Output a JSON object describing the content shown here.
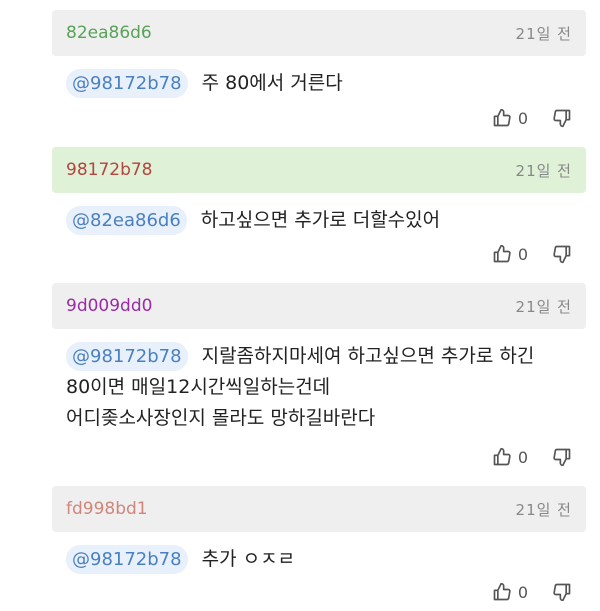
{
  "comments": [
    {
      "username": "82ea86d6",
      "user_color": "#5aa15a",
      "header_bg": "#efefef",
      "time": "21일 전",
      "mention": "@98172b78",
      "lines": [
        "주 80에서 거른다"
      ],
      "likes": "0"
    },
    {
      "username": "98172b78",
      "user_color": "#b5433f",
      "header_bg": "#dff1d6",
      "time": "21일 전",
      "mention": "@82ea86d6",
      "lines": [
        "하고싶으면 추가로 더할수있어"
      ],
      "likes": "0"
    },
    {
      "username": "9d009dd0",
      "user_color": "#9a2aa8",
      "header_bg": "#efefef",
      "time": "21일 전",
      "mention": "@98172b78",
      "lines": [
        "지랄좀하지마세여 하고싶으면 추가로 하긴",
        "80이면 매일12시간씩일하는건데",
        "어디좆소사장인지 몰라도 망하길바란다"
      ],
      "likes": "0"
    },
    {
      "username": "fd998bd1",
      "user_color": "#d0867a",
      "header_bg": "#efefef",
      "time": "21일 전",
      "mention": "@98172b78",
      "lines": [
        "추가 ㅇㅈㄹ"
      ],
      "likes": "0"
    }
  ]
}
